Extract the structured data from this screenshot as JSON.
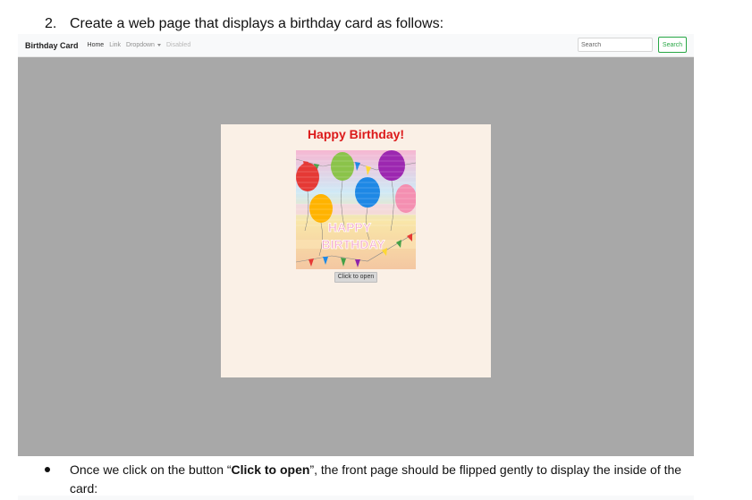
{
  "question": {
    "number": "2.",
    "text": "Create a web page that displays a birthday card as follows:"
  },
  "navbar": {
    "brand": "Birthday Card",
    "links": [
      "Home",
      "Link",
      "Dropdown",
      "Disabled"
    ],
    "search_placeholder": "Search",
    "search_button": "Search",
    "accent_color": "#28a745"
  },
  "card": {
    "title": "Happy Birthday!",
    "image_text_line1": "HAPPY",
    "image_text_line2": "BIRTHDAY",
    "open_button": "Click to open",
    "background": "#faf0e6",
    "title_color": "#dc1a1a"
  },
  "bullet": {
    "before": "Once we click on the button “",
    "bold": "Click to open",
    "after": "”, the front page should be flipped gently to display the inside of the card:"
  }
}
